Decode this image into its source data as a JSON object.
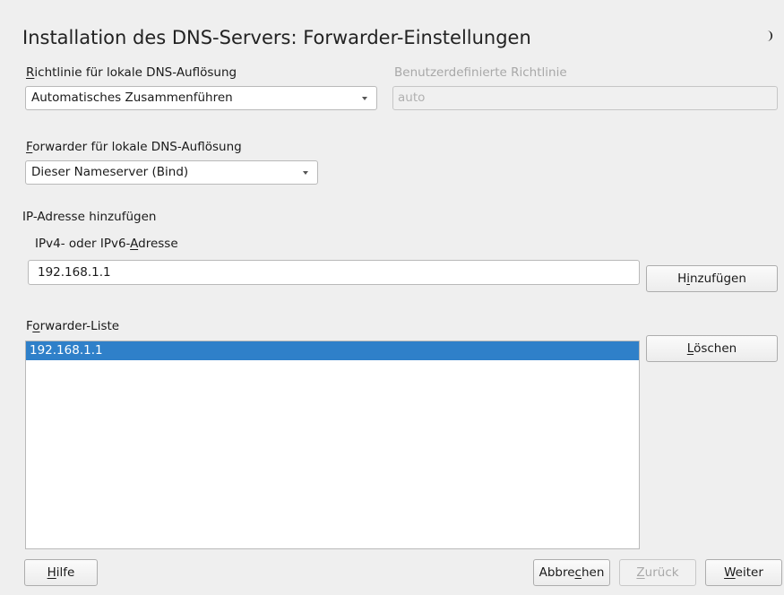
{
  "window": {
    "title": "Installation des DNS-Servers: Forwarder-Einstellungen",
    "theme_icon": "moon-icon"
  },
  "policy": {
    "label_mnemonic": "R",
    "label_rest": "ichtlinie für lokale DNS-Auflösung",
    "selected": "Automatisches Zusammenführen"
  },
  "custom_policy": {
    "label": "Benutzerdefinierte Richtlinie",
    "value": "auto"
  },
  "forwarder": {
    "label_mnemonic": "F",
    "label_rest": "orwarder für lokale DNS-Auflösung",
    "selected": "Dieser Nameserver (Bind)"
  },
  "add_ip": {
    "heading": "IP-Adresse hinzufügen",
    "field_label_pre": "IPv4- oder IPv6-",
    "field_label_mnemonic": "A",
    "field_label_post": "dresse",
    "value": "192.168.1.1",
    "button_pre": "H",
    "button_mnemonic": "i",
    "button_post": "nzufügen"
  },
  "forwarder_list": {
    "label_pre": "F",
    "label_mnemonic": "o",
    "label_post": "rwarder-Liste",
    "items": [
      "192.168.1.1"
    ],
    "delete_mnemonic": "L",
    "delete_rest": "öschen"
  },
  "footer": {
    "help_mnemonic": "H",
    "help_rest": "ilfe",
    "abort_pre": "Abbre",
    "abort_mnemonic": "c",
    "abort_post": "hen",
    "back_mnemonic": "Z",
    "back_rest": "urück",
    "next_mnemonic": "W",
    "next_rest": "eiter"
  },
  "colors": {
    "background": "#efefef",
    "selection": "#2f80c9"
  }
}
